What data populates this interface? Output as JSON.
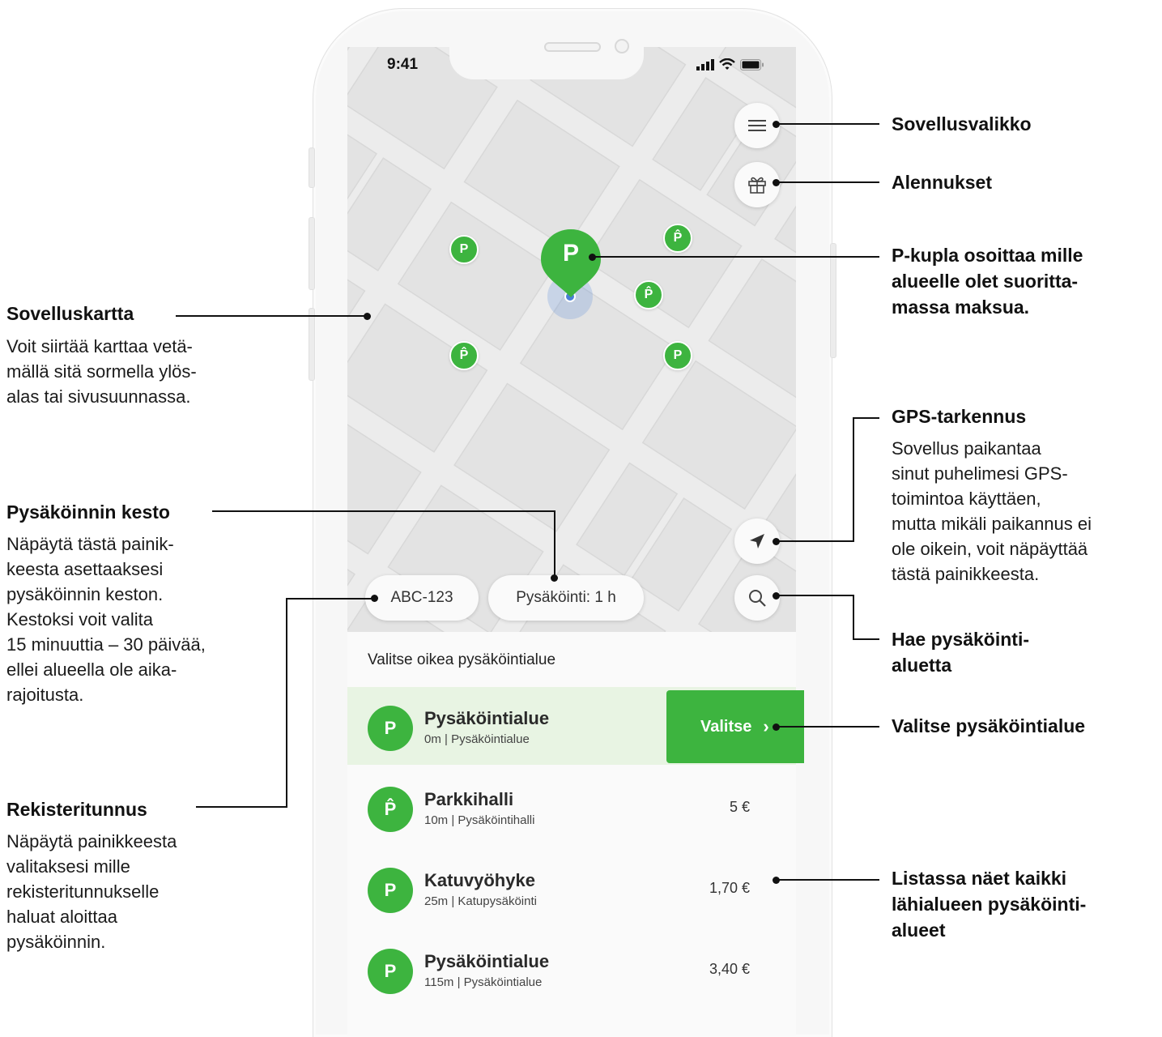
{
  "status_bar": {
    "time": "9:41"
  },
  "map": {
    "chips": {
      "plate": "ABC-123",
      "duration": "Pysäköinti: 1 h"
    },
    "marker_label": "P",
    "small_marker_labels": {
      "flat": "P",
      "garage": "P̂"
    }
  },
  "list": {
    "heading": "Valitse oikea pysäköintialue",
    "select_label": "Valitse",
    "rows": [
      {
        "icon": "P",
        "title": "Pysäköintialue",
        "subtitle": "0m | Pysäköintialue",
        "price": ""
      },
      {
        "icon": "P̂",
        "title": "Parkkihalli",
        "subtitle": "10m | Pysäköintihalli",
        "price": "5 €"
      },
      {
        "icon": "P",
        "title": "Katuvyöhyke",
        "subtitle": "25m | Katupysäköinti",
        "price": "1,70 €"
      },
      {
        "icon": "P",
        "title": "Pysäköintialue",
        "subtitle": "115m | Pysäköintialue",
        "price": "3,40 €"
      }
    ]
  },
  "annotations": {
    "left": {
      "map": {
        "title": "Sovelluskartta",
        "lines": [
          "Voit siirtää karttaa vetä-",
          "mällä sitä sormella ylös-",
          "alas tai sivusuunnassa."
        ]
      },
      "duration": {
        "title": "Pysäköinnin kesto",
        "lines": [
          "Näpäytä tästä painik-",
          "keesta asettaaksesi",
          "pysäköinnin keston.",
          "Kestoksi voit valita",
          "15 minuuttia – 30 päivää,",
          "ellei alueella ole aika-",
          "rajoitusta."
        ]
      },
      "plate": {
        "title": "Rekisteritunnus",
        "lines": [
          "Näpäytä painikkeesta",
          "valitaksesi mille",
          "rekisteritunnukselle",
          "haluat aloittaa",
          "pysäköinnin."
        ]
      }
    },
    "right": {
      "menu": {
        "title": "Sovellusvalikko"
      },
      "discounts": {
        "title": "Alennukset"
      },
      "bubble": {
        "lines": [
          "P-kupla osoittaa mille",
          "alueelle olet suoritta-",
          "massa maksua."
        ]
      },
      "gps": {
        "title": "GPS-tarkennus",
        "lines": [
          "Sovellus paikantaa",
          "sinut puhelimesi GPS-",
          "toimintoa käyttäen,",
          "mutta mikäli paikannus ei",
          "ole oikein, voit näpäyttää",
          "tästä painikkeesta."
        ]
      },
      "search": {
        "lines": [
          "Hae pysäköinti-",
          "aluetta"
        ]
      },
      "select": {
        "title": "Valitse pysäköintialue"
      },
      "list": {
        "lines": [
          "Listassa näet kaikki",
          "lähialueen pysäköinti-",
          "alueet"
        ]
      }
    }
  },
  "colors": {
    "brand_green": "#3db43f",
    "selected_row": "#e8f4e3",
    "user_location": "#4a7fd4"
  },
  "icons": [
    "menu-icon",
    "gift-icon",
    "location-arrow-icon",
    "search-icon",
    "signal-icon",
    "wifi-icon",
    "battery-icon"
  ]
}
